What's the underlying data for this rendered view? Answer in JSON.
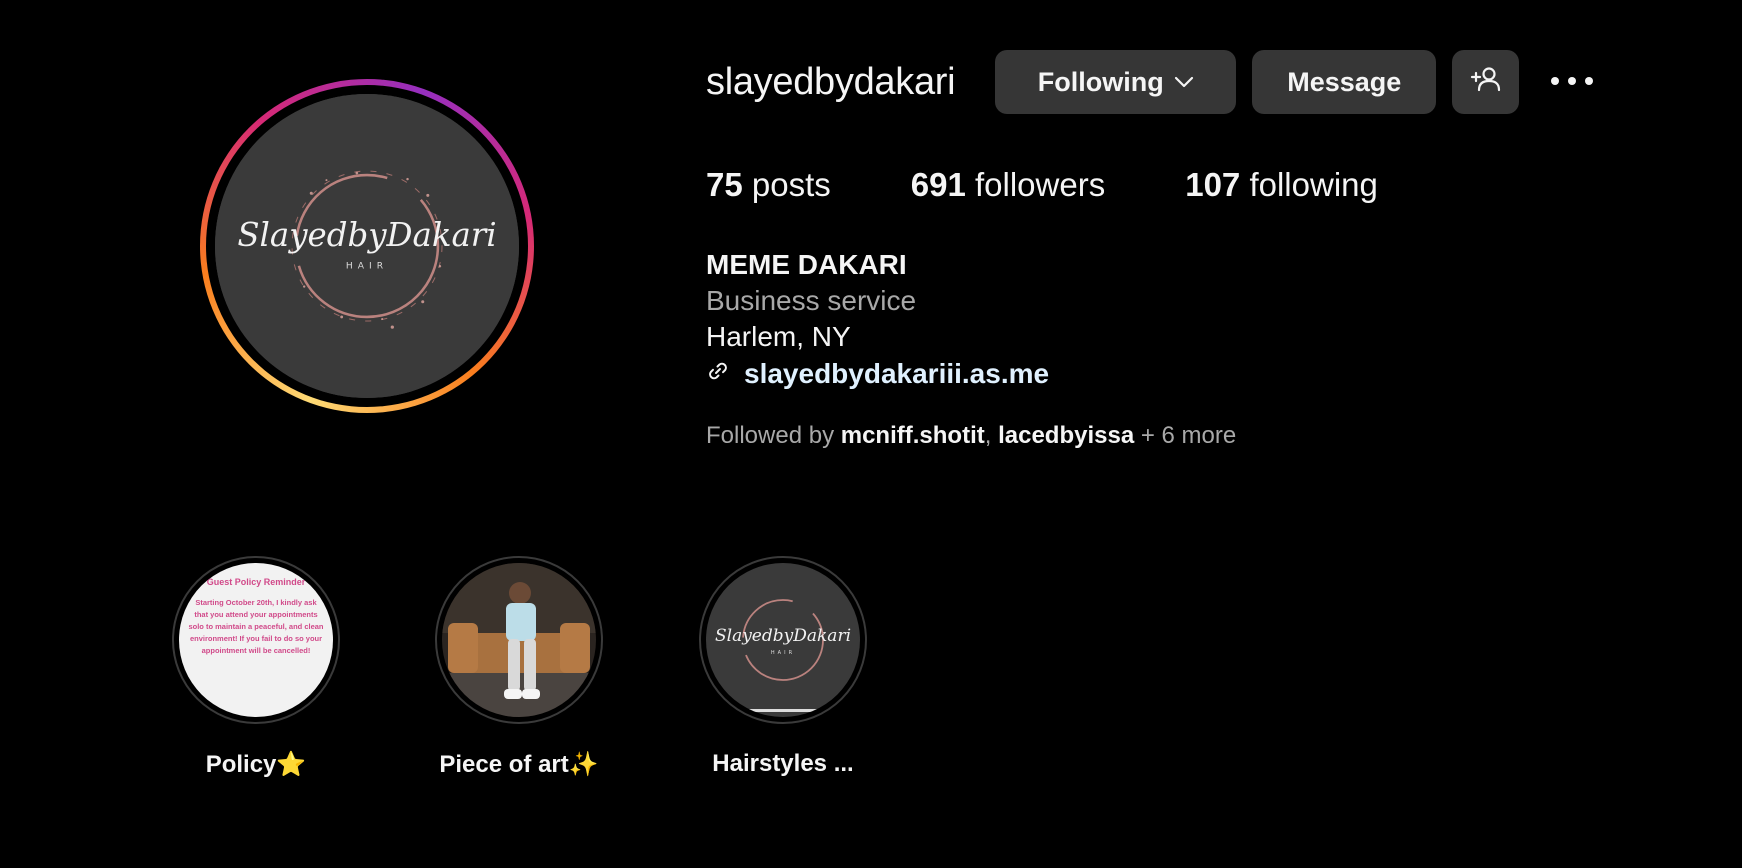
{
  "profile": {
    "username": "slayedbydakari",
    "avatar_logo_text": "SlayedbyDakari",
    "avatar_logo_subtext": "HAIR"
  },
  "actions": {
    "following_label": "Following",
    "message_label": "Message",
    "add_user_icon": "person-add-icon",
    "more_icon": "more-options-icon"
  },
  "stats": {
    "posts_count": "75",
    "posts_label": "posts",
    "followers_count": "691",
    "followers_label": "followers",
    "following_count": "107",
    "following_label": "following"
  },
  "bio": {
    "name": "MEME DAKARI",
    "category": "Business service",
    "location": "Harlem, NY",
    "link": "slayedbydakariii.as.me",
    "link_icon": "link-icon"
  },
  "followed_by": {
    "prefix": "Followed by ",
    "users": [
      "mcniff.shotit",
      "lacedbyissa"
    ],
    "separator": ", ",
    "more": " + 6 more"
  },
  "highlights": [
    {
      "label": "Policy⭐",
      "thumb_title": "Guest Policy Reminder",
      "thumb_lines": [
        "Starting October 20th, I kindly ask",
        "that you attend your appointments",
        "solo to maintain a peaceful, and clean",
        "environment! If you fail to do so your",
        "appointment will be cancelled!"
      ]
    },
    {
      "label": "Piece of art✨"
    },
    {
      "label": "Hairstyles ...",
      "thumb_logo_text": "SlayedbyDakari",
      "thumb_logo_subtext": "HAIR"
    }
  ],
  "colors": {
    "background": "#000000",
    "button_bg": "#363636",
    "text_primary": "#f5f5f5",
    "text_secondary": "#a8a8a8",
    "link": "#e0f1ff",
    "story_ring_start": "#feda75",
    "story_ring_end": "#962fbf"
  }
}
